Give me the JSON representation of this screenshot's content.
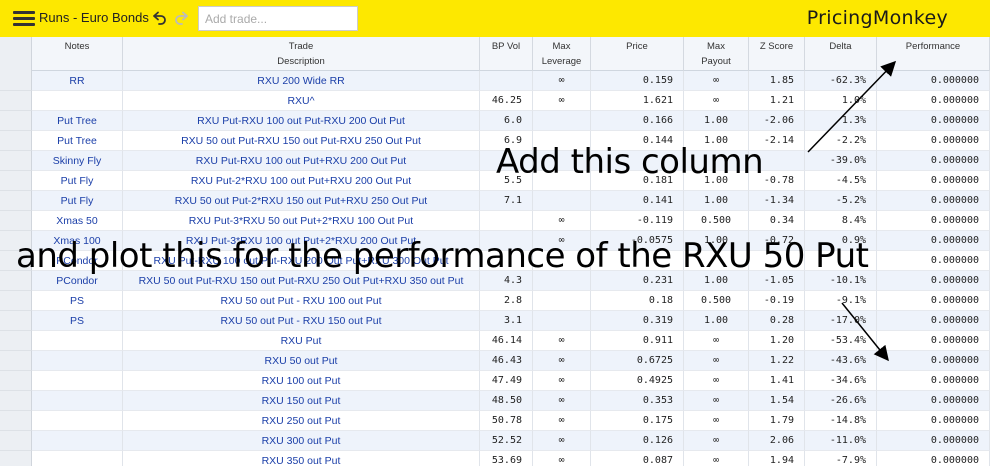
{
  "header": {
    "app_title": "Runs - Euro Bonds",
    "add_trade_placeholder": "Add trade...",
    "brand": "PricingMonkey"
  },
  "columns": [
    {
      "key": "notes",
      "line1": "Notes",
      "line2": ""
    },
    {
      "key": "desc",
      "line1": "Trade",
      "line2": "Description"
    },
    {
      "key": "bpvol",
      "line1": "BP Vol",
      "line2": ""
    },
    {
      "key": "maxlev",
      "line1": "Max",
      "line2": "Leverage"
    },
    {
      "key": "price",
      "line1": "Price",
      "line2": ""
    },
    {
      "key": "maxpay",
      "line1": "Max",
      "line2": "Payout"
    },
    {
      "key": "zscore",
      "line1": "Z Score",
      "line2": ""
    },
    {
      "key": "delta",
      "line1": "Delta",
      "line2": ""
    },
    {
      "key": "perf",
      "line1": "Performance",
      "line2": ""
    }
  ],
  "rows": [
    {
      "notes": "RR",
      "desc": "RXU 200 Wide RR",
      "bpvol": "",
      "maxlev": "∞",
      "price": "0.159",
      "maxpay": "∞",
      "zscore": "1.85",
      "delta": "-62.3%",
      "perf": "0.000000"
    },
    {
      "notes": "",
      "desc": "RXU^",
      "bpvol": "46.25",
      "maxlev": "∞",
      "price": "1.621",
      "maxpay": "∞",
      "zscore": "1.21",
      "delta": "1.0%",
      "perf": "0.000000"
    },
    {
      "notes": "Put Tree",
      "desc": "RXU Put-RXU 100 out Put-RXU 200 Out Put",
      "bpvol": "6.0",
      "maxlev": "",
      "price": "0.166",
      "maxpay": "1.00",
      "zscore": "-2.06",
      "delta": "1.3%",
      "perf": "0.000000"
    },
    {
      "notes": "Put Tree",
      "desc": "RXU 50 out Put-RXU 150 out Put-RXU 250 Out Put",
      "bpvol": "6.9",
      "maxlev": "",
      "price": "0.144",
      "maxpay": "1.00",
      "zscore": "-2.14",
      "delta": "-2.2%",
      "perf": "0.000000"
    },
    {
      "notes": "Skinny Fly",
      "desc": "RXU Put-RXU 100 out Put+RXU 200 Out Put",
      "bpvol": "",
      "maxlev": "",
      "price": "",
      "maxpay": "",
      "zscore": "",
      "delta": "-39.0%",
      "perf": "0.000000"
    },
    {
      "notes": "Put Fly",
      "desc": "RXU Put-2*RXU 100 out Put+RXU 200 Out Put",
      "bpvol": "5.5",
      "maxlev": "",
      "price": "0.181",
      "maxpay": "1.00",
      "zscore": "-0.78",
      "delta": "-4.5%",
      "perf": "0.000000"
    },
    {
      "notes": "Put Fly",
      "desc": "RXU 50 out Put-2*RXU 150 out Put+RXU 250 Out Put",
      "bpvol": "7.1",
      "maxlev": "",
      "price": "0.141",
      "maxpay": "1.00",
      "zscore": "-1.34",
      "delta": "-5.2%",
      "perf": "0.000000"
    },
    {
      "notes": "Xmas 50",
      "desc": "RXU Put-3*RXU 50 out Put+2*RXU 100 Out Put",
      "bpvol": "",
      "maxlev": "∞",
      "price": "-0.119",
      "maxpay": "0.500",
      "zscore": "0.34",
      "delta": "8.4%",
      "perf": "0.000000"
    },
    {
      "notes": "Xmas 100",
      "desc": "RXU Put-3*RXU 100 out Put+2*RXU 200 Out Put",
      "bpvol": "",
      "maxlev": "∞",
      "price": "-0.0575",
      "maxpay": "1.00",
      "zscore": "-0.72",
      "delta": "0.9%",
      "perf": "0.000000"
    },
    {
      "notes": "PCondor",
      "desc": "RXU Put-RXU 100 out Put-RXU 200 Out Put+RXU 300 Out Put",
      "bpvol": "",
      "maxlev": "",
      "price": "",
      "maxpay": "",
      "zscore": "",
      "delta": "",
      "perf": "0.000000"
    },
    {
      "notes": "PCondor",
      "desc": "RXU 50 out Put-RXU 150 out Put-RXU 250 Out Put+RXU 350 out Put",
      "bpvol": "4.3",
      "maxlev": "",
      "price": "0.231",
      "maxpay": "1.00",
      "zscore": "-1.05",
      "delta": "-10.1%",
      "perf": "0.000000"
    },
    {
      "notes": "PS",
      "desc": "RXU 50 out Put - RXU 100 out Put",
      "bpvol": "2.8",
      "maxlev": "",
      "price": "0.18",
      "maxpay": "0.500",
      "zscore": "-0.19",
      "delta": "-9.1%",
      "perf": "0.000000"
    },
    {
      "notes": "PS",
      "desc": "RXU 50 out Put - RXU 150 out Put",
      "bpvol": "3.1",
      "maxlev": "",
      "price": "0.319",
      "maxpay": "1.00",
      "zscore": "0.28",
      "delta": "-17.0%",
      "perf": "0.000000"
    },
    {
      "notes": "",
      "desc": "RXU Put",
      "bpvol": "46.14",
      "maxlev": "∞",
      "price": "0.911",
      "maxpay": "∞",
      "zscore": "1.20",
      "delta": "-53.4%",
      "perf": "0.000000"
    },
    {
      "notes": "",
      "desc": "RXU 50 out Put",
      "bpvol": "46.43",
      "maxlev": "∞",
      "price": "0.6725",
      "maxpay": "∞",
      "zscore": "1.22",
      "delta": "-43.6%",
      "perf": "0.000000"
    },
    {
      "notes": "",
      "desc": "RXU 100 out Put",
      "bpvol": "47.49",
      "maxlev": "∞",
      "price": "0.4925",
      "maxpay": "∞",
      "zscore": "1.41",
      "delta": "-34.6%",
      "perf": "0.000000"
    },
    {
      "notes": "",
      "desc": "RXU 150 out Put",
      "bpvol": "48.50",
      "maxlev": "∞",
      "price": "0.353",
      "maxpay": "∞",
      "zscore": "1.54",
      "delta": "-26.6%",
      "perf": "0.000000"
    },
    {
      "notes": "",
      "desc": "RXU 250 out Put",
      "bpvol": "50.78",
      "maxlev": "∞",
      "price": "0.175",
      "maxpay": "∞",
      "zscore": "1.79",
      "delta": "-14.8%",
      "perf": "0.000000"
    },
    {
      "notes": "",
      "desc": "RXU 300 out Put",
      "bpvol": "52.52",
      "maxlev": "∞",
      "price": "0.126",
      "maxpay": "∞",
      "zscore": "2.06",
      "delta": "-11.0%",
      "perf": "0.000000"
    },
    {
      "notes": "",
      "desc": "RXU 350 out Put",
      "bpvol": "53.69",
      "maxlev": "∞",
      "price": "0.087",
      "maxpay": "∞",
      "zscore": "1.94",
      "delta": "-7.9%",
      "perf": "0.000000"
    }
  ],
  "annotations": {
    "line1": "Add this column",
    "line2": "and plot this for the performance of the RXU 50 Put"
  },
  "colors": {
    "topbar": "#fde800",
    "link_text": "#1a3ea8",
    "row_alt": "#eef3fb"
  }
}
